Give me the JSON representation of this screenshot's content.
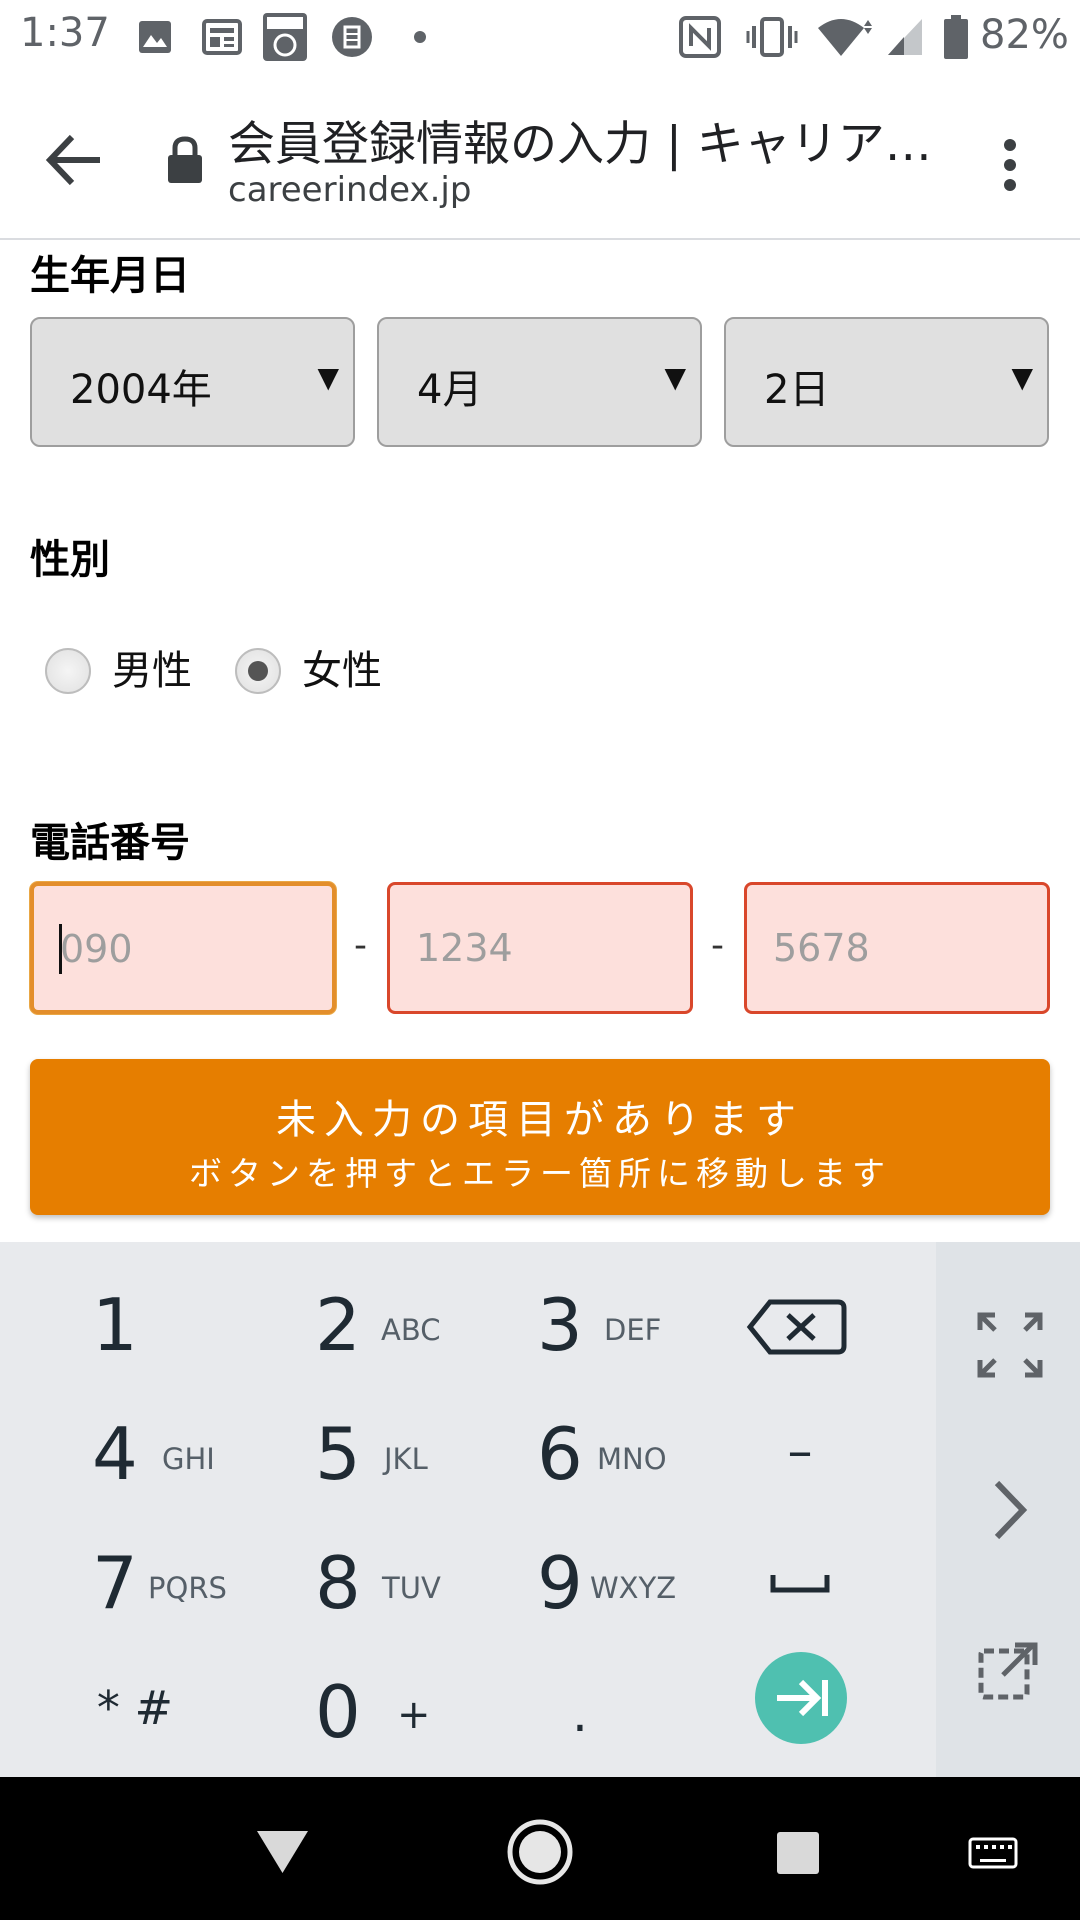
{
  "status_bar": {
    "time": "1:37",
    "battery": "82%",
    "icons": [
      "image-icon",
      "news-icon",
      "townwork-icon",
      "app-icon",
      "dot-icon",
      "nfc-icon",
      "vibrate-icon",
      "wifi-icon",
      "signal-icon",
      "battery-icon"
    ]
  },
  "browser": {
    "title": "会員登録情報の入力 | キャリア…",
    "url": "careerindex.jp"
  },
  "form": {
    "birthdate": {
      "label": "生年月日",
      "year": "2004年",
      "month": "4月",
      "day": "2日"
    },
    "gender": {
      "label": "性別",
      "options": [
        {
          "label": "男性",
          "selected": false
        },
        {
          "label": "女性",
          "selected": true
        }
      ]
    },
    "phone": {
      "label": "電話番号",
      "placeholders": [
        "090",
        "1234",
        "5678"
      ],
      "separator": "-"
    },
    "error_button": {
      "line1": "未入力の項目があります",
      "line2": "ボタンを押すとエラー箇所に移動します"
    }
  },
  "keyboard": {
    "keys": [
      {
        "main": "1",
        "sub": ""
      },
      {
        "main": "2",
        "sub": "ABC"
      },
      {
        "main": "3",
        "sub": "DEF"
      },
      {
        "main": "4",
        "sub": "GHI"
      },
      {
        "main": "5",
        "sub": "JKL"
      },
      {
        "main": "6",
        "sub": "MNO"
      },
      {
        "main": "7",
        "sub": "PQRS"
      },
      {
        "main": "8",
        "sub": "TUV"
      },
      {
        "main": "9",
        "sub": "WXYZ"
      },
      {
        "main": "0",
        "sub": "+"
      }
    ],
    "star_hash": "* #",
    "minus": "–",
    "period": ".",
    "accent": "#4fc0b0"
  },
  "colors": {
    "error_orange": "#e67e00",
    "input_error_border": "#d9472b",
    "input_error_bg": "#fde0dc"
  }
}
